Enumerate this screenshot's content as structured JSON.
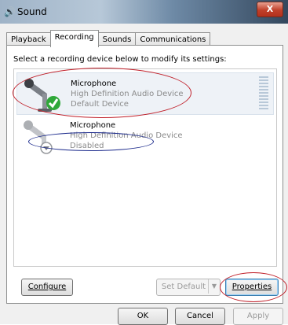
{
  "window": {
    "title": "Sound",
    "close_label": "X"
  },
  "tabs": [
    {
      "label": "Playback"
    },
    {
      "label": "Recording",
      "active": true
    },
    {
      "label": "Sounds"
    },
    {
      "label": "Communications"
    }
  ],
  "instruction": "Select a recording device below to modify its settings:",
  "devices": [
    {
      "name": "Microphone",
      "description": "High Definition Audio Device",
      "status": "Default Device",
      "selected": true,
      "status_icon": "checkmark-icon"
    },
    {
      "name": "Microphone",
      "description": "High Definition Audio Device",
      "status": "Disabled",
      "selected": false,
      "status_icon": "disabled-down-arrow-icon"
    }
  ],
  "buttons": {
    "configure": "Configure",
    "set_default": "Set Default",
    "properties": "Properties",
    "ok": "OK",
    "cancel": "Cancel",
    "apply": "Apply"
  },
  "annotation_color": "#c0202a",
  "annotation_color_secondary": "#1b2a8c"
}
